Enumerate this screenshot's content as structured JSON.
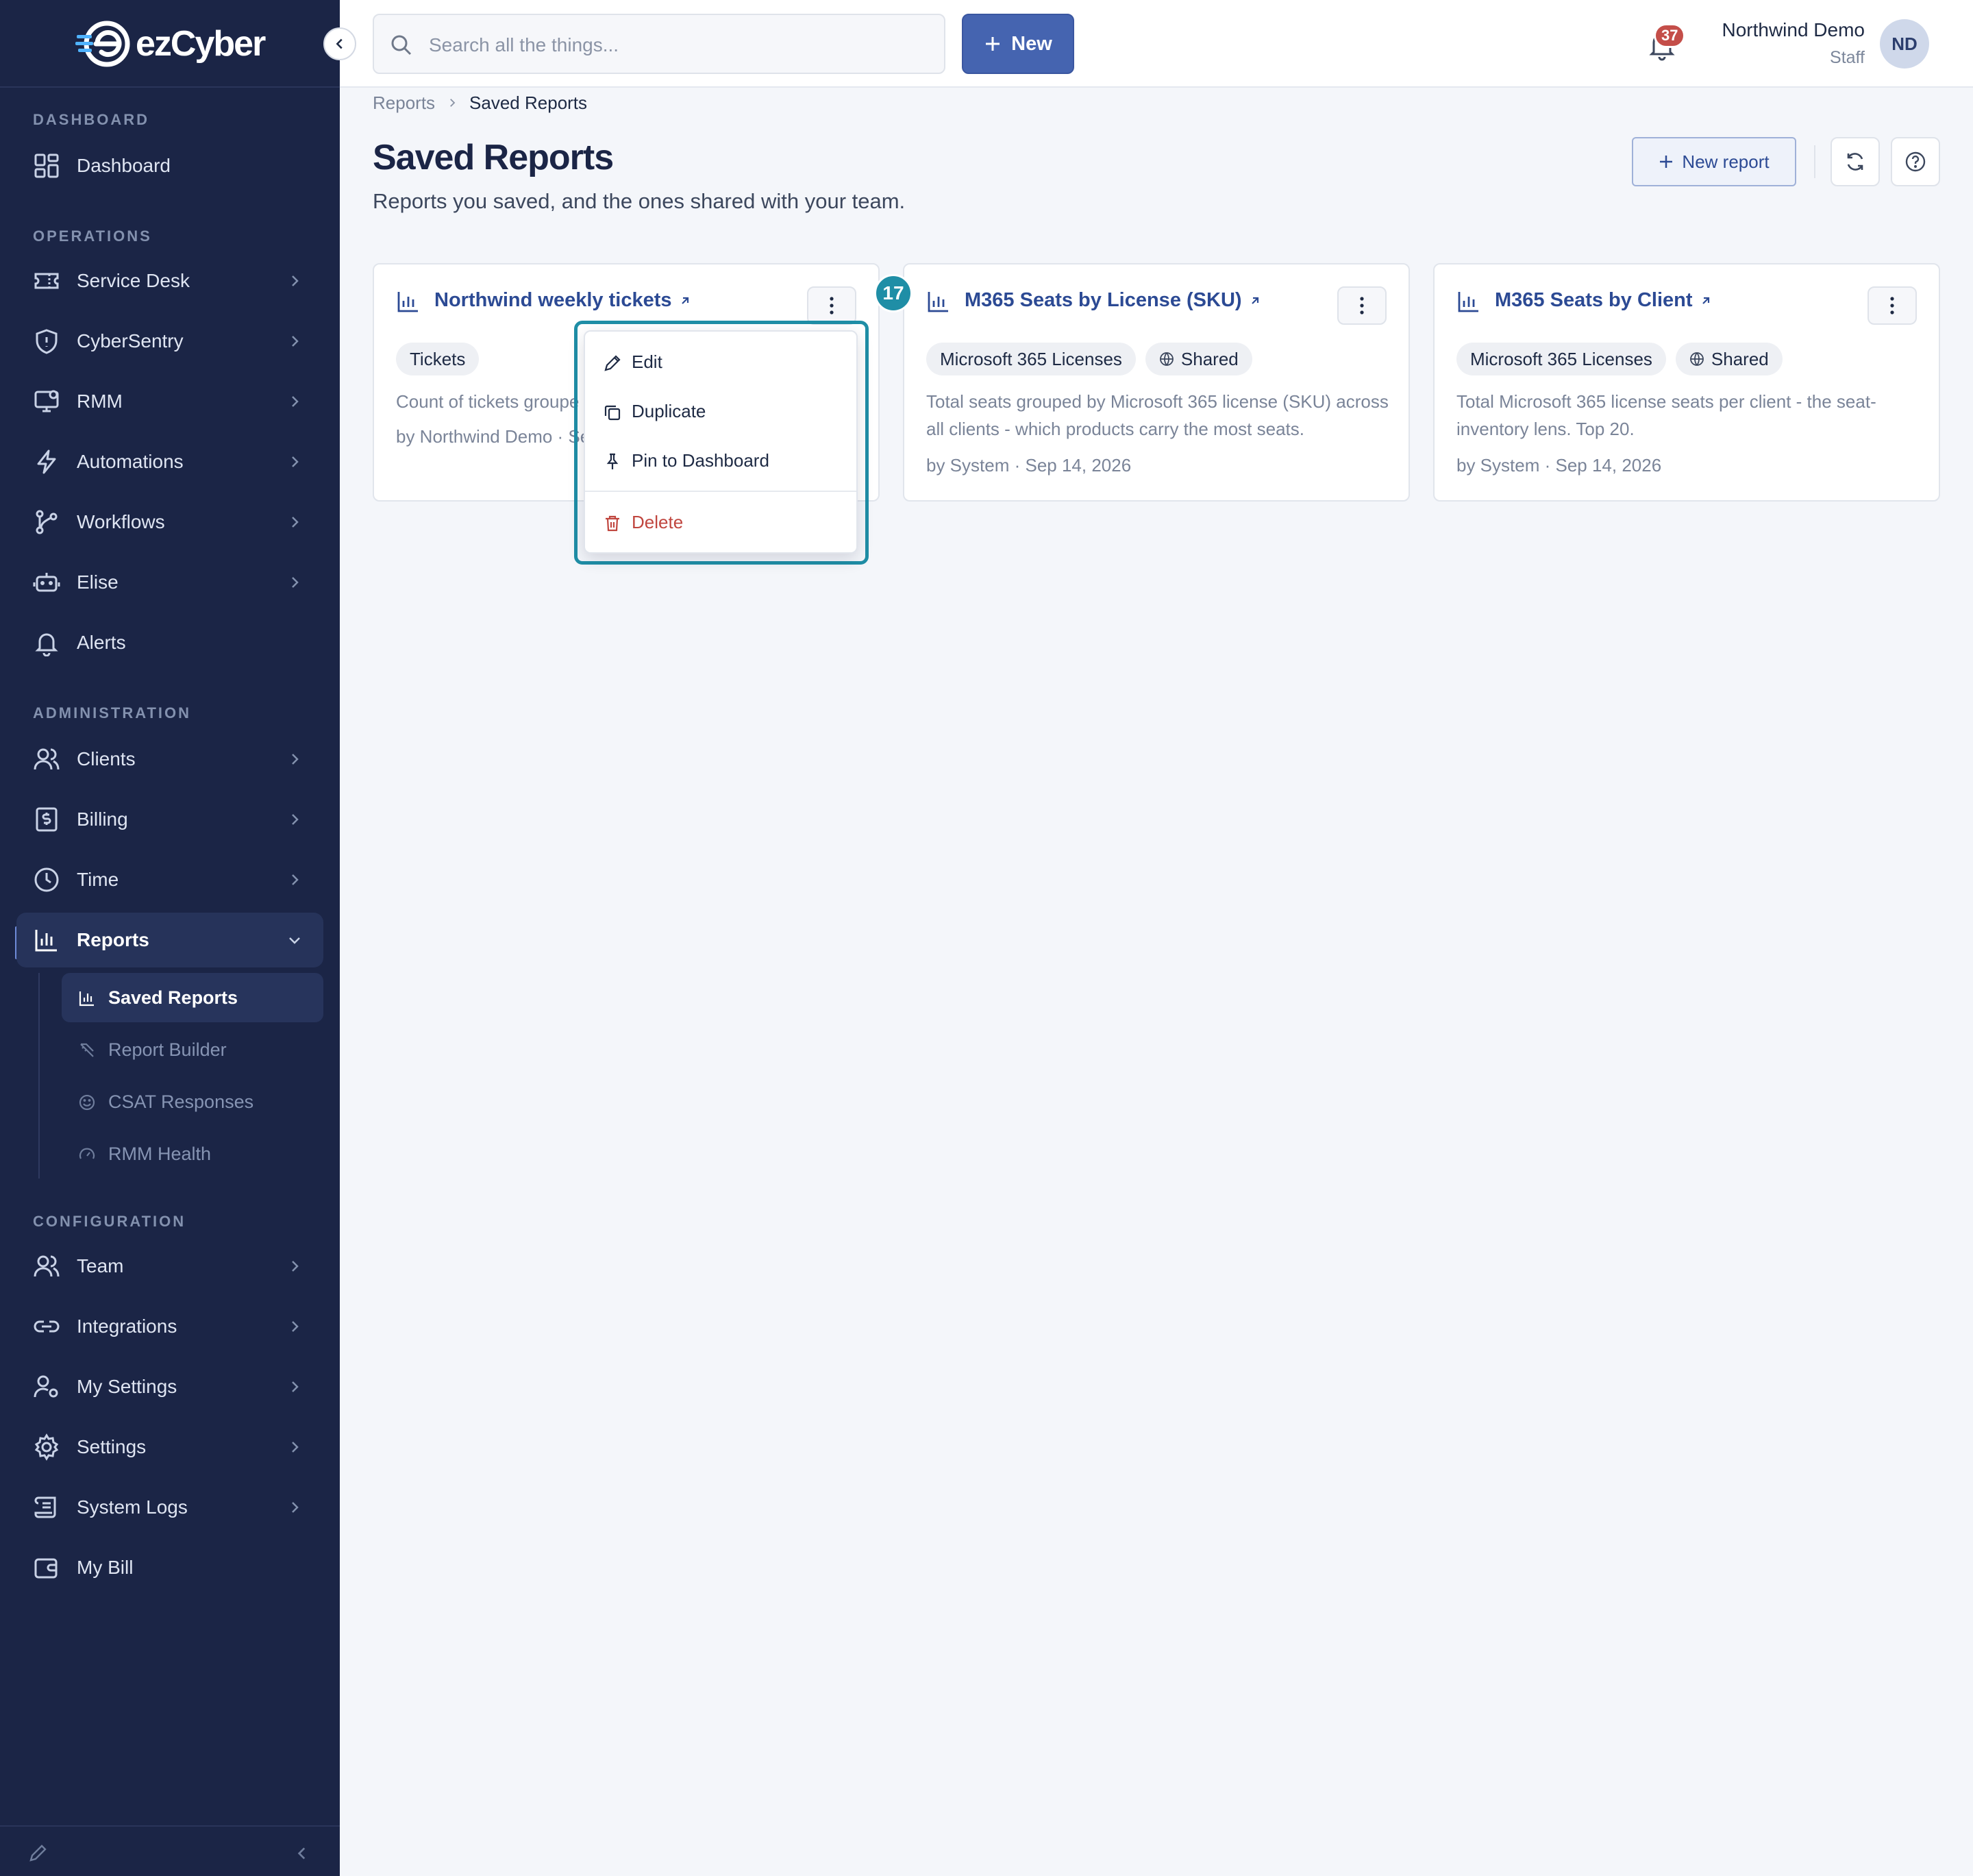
{
  "brand": {
    "name": "ezCyber"
  },
  "sidebar": {
    "sections": [
      {
        "label": "DASHBOARD"
      },
      {
        "label": "OPERATIONS"
      },
      {
        "label": "ADMINISTRATION"
      },
      {
        "label": "CONFIGURATION"
      }
    ],
    "items": [
      {
        "label": "Dashboard",
        "icon": "dashboard-icon",
        "chevron": false
      },
      {
        "label": "Service Desk",
        "icon": "ticket-icon",
        "chevron": true
      },
      {
        "label": "CyberSentry",
        "icon": "shield-icon",
        "chevron": true
      },
      {
        "label": "RMM",
        "icon": "monitor-icon",
        "chevron": true
      },
      {
        "label": "Automations",
        "icon": "lightning-icon",
        "chevron": true
      },
      {
        "label": "Workflows",
        "icon": "workflow-icon",
        "chevron": true
      },
      {
        "label": "Elise",
        "icon": "robot-icon",
        "chevron": true
      },
      {
        "label": "Alerts",
        "icon": "bell-icon",
        "chevron": false
      },
      {
        "label": "Clients",
        "icon": "users-icon",
        "chevron": true
      },
      {
        "label": "Billing",
        "icon": "billing-icon",
        "chevron": true
      },
      {
        "label": "Time",
        "icon": "clock-icon",
        "chevron": true
      },
      {
        "label": "Reports",
        "icon": "bar-chart-icon",
        "chevron": true,
        "expanded": true,
        "active": true
      },
      {
        "label": "Team",
        "icon": "team-icon",
        "chevron": true
      },
      {
        "label": "Integrations",
        "icon": "link-icon",
        "chevron": true
      },
      {
        "label": "My Settings",
        "icon": "user-gear-icon",
        "chevron": true
      },
      {
        "label": "Settings",
        "icon": "gear-icon",
        "chevron": true
      },
      {
        "label": "System Logs",
        "icon": "scroll-icon",
        "chevron": true
      },
      {
        "label": "My Bill",
        "icon": "wallet-icon",
        "chevron": false
      }
    ],
    "reports_sub": [
      {
        "label": "Saved Reports",
        "icon": "bar-chart-icon",
        "active": true
      },
      {
        "label": "Report Builder",
        "icon": "ruler-pencil-icon"
      },
      {
        "label": "CSAT Responses",
        "icon": "smile-icon"
      },
      {
        "label": "RMM Health",
        "icon": "gauge-icon"
      }
    ]
  },
  "topbar": {
    "search_placeholder": "Search all the things...",
    "new_label": "New",
    "notifications_count": "37",
    "user_name": "Northwind Demo",
    "user_role": "Staff",
    "avatar_initials": "ND"
  },
  "breadcrumb": {
    "parent": "Reports",
    "current": "Saved Reports"
  },
  "page": {
    "title": "Saved Reports",
    "subtitle": "Reports you saved, and the ones shared with your team.",
    "new_report_label": "New report"
  },
  "cards": [
    {
      "title": "Northwind weekly tickets",
      "tags": [
        "Tickets"
      ],
      "shared": false,
      "description": "Count of tickets groupe",
      "meta": "by Northwind Demo · Se"
    },
    {
      "title": "M365 Seats by License (SKU)",
      "tags": [
        "Microsoft 365 Licenses"
      ],
      "shared": true,
      "shared_label": "Shared",
      "description": "Total seats grouped by Microsoft 365 license (SKU) across all clients - which products carry the most seats.",
      "meta": "by System · Sep 14, 2026"
    },
    {
      "title": "M365 Seats by Client",
      "tags": [
        "Microsoft 365 Licenses"
      ],
      "shared": true,
      "shared_label": "Shared",
      "description": "Total Microsoft 365 license seats per client - the seat-inventory lens. Top 20.",
      "meta": "by System · Sep 14, 2026"
    }
  ],
  "card_menu": {
    "items": [
      {
        "label": "Edit",
        "icon": "pencil-icon"
      },
      {
        "label": "Duplicate",
        "icon": "copy-icon"
      },
      {
        "label": "Pin to Dashboard",
        "icon": "pin-icon"
      },
      {
        "label": "Delete",
        "icon": "trash-icon",
        "danger": true
      }
    ],
    "step_badge": "17"
  },
  "colors": {
    "sidebar_bg": "#1b2546",
    "accent": "#4564b0",
    "highlight": "#1f8ea6",
    "danger": "#c0463f"
  }
}
